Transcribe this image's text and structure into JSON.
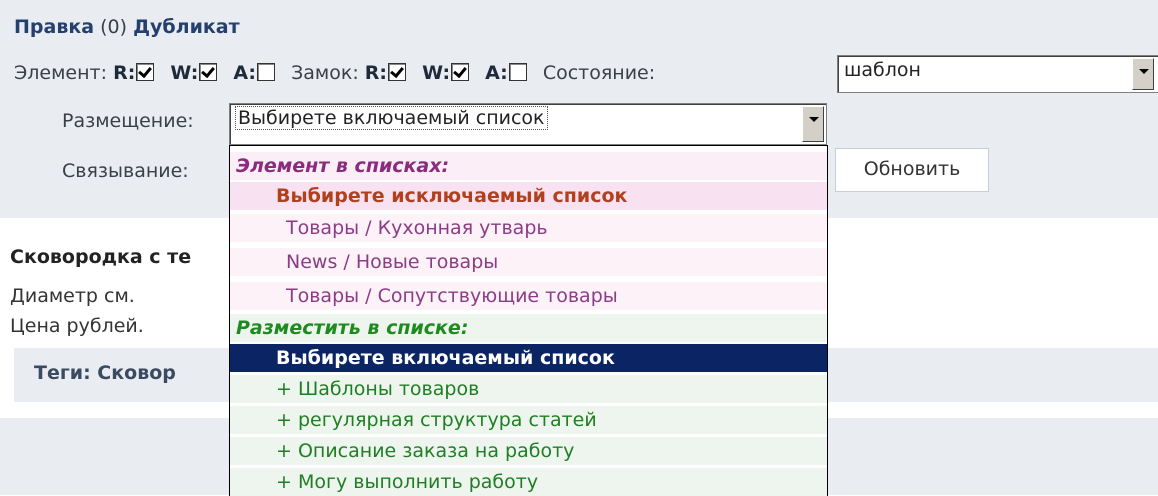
{
  "header": {
    "edit_link": "Правка",
    "count": "(0)",
    "duplicate_link": "Дубликат"
  },
  "permissions": {
    "element_label": "Элемент:",
    "lock_label": "Замок:",
    "r": "R:",
    "w": "W:",
    "a": "A:",
    "state_label": "Состояние:",
    "state_value": "шаблон"
  },
  "placement": {
    "label": "Размещение:",
    "value": "Выбирете включаемый список"
  },
  "linking": {
    "label": "Связывание:",
    "button": "Обновить"
  },
  "product": {
    "title": "Сковородка с те",
    "diameter": "Диаметр см.",
    "price": "Цена рублей."
  },
  "tags": {
    "label": "Теги: Сковор"
  },
  "dropdown": {
    "group1": "Элемент в списках:",
    "exclude": "Выбирете исключаемый список",
    "items1": [
      "Товары / Кухонная утварь",
      "News / Новые товары",
      "Товары / Сопутствующие товары"
    ],
    "group2": "Разместить в списке:",
    "include": "Выбирете включаемый список",
    "items2": [
      "+ Шаблоны товаров",
      "+ регулярная структура статей",
      "+ Описание заказа на работу",
      "+ Могу выполнить работу"
    ]
  }
}
